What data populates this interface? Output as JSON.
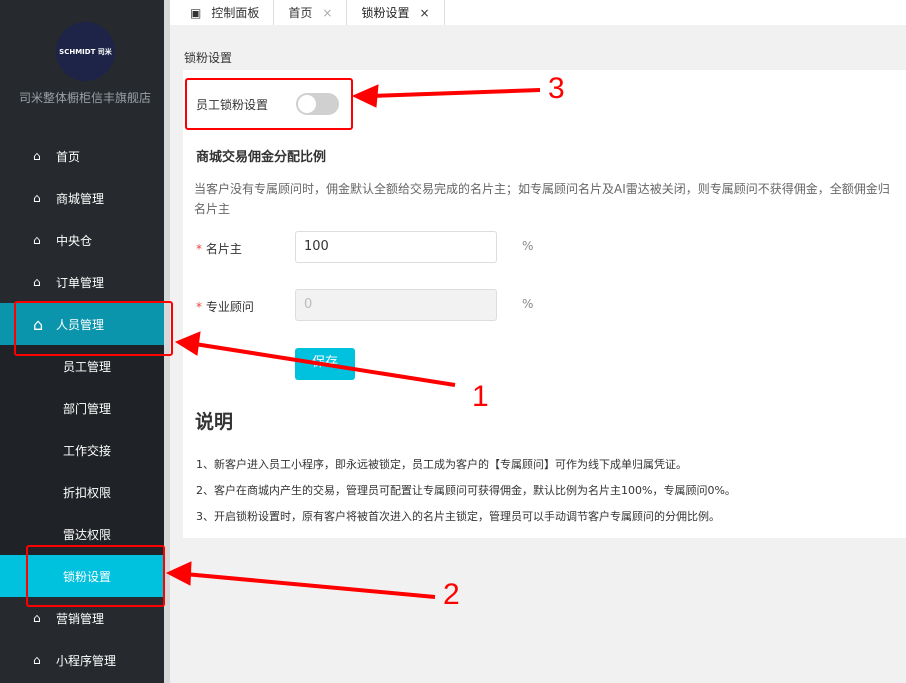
{
  "sidebar": {
    "logo_text": "SCHMIDT 司米",
    "shop_name": "司米整体橱柜信丰旗舰店",
    "items": [
      {
        "label": "首页"
      },
      {
        "label": "商城管理"
      },
      {
        "label": "中央仓"
      },
      {
        "label": "订单管理"
      },
      {
        "label": "人员管理"
      }
    ],
    "sub_items": [
      {
        "label": "员工管理"
      },
      {
        "label": "部门管理"
      },
      {
        "label": "工作交接"
      },
      {
        "label": "折扣权限"
      },
      {
        "label": "雷达权限"
      },
      {
        "label": "锁粉设置"
      }
    ],
    "items_after": [
      {
        "label": "营销管理"
      },
      {
        "label": "小程序管理"
      }
    ]
  },
  "tabs": [
    {
      "label": "控制面板",
      "icon": "dashboard-icon"
    },
    {
      "label": "首页"
    },
    {
      "label": "锁粉设置"
    }
  ],
  "breadcrumb": "锁粉设置",
  "form": {
    "lock_label": "员工锁粉设置",
    "lock_enabled": false,
    "section_title": "商城交易佣金分配比例",
    "description": "当客户没有专属顾问时，佣金默认全额给交易完成的名片主；如专属顾问名片及AI雷达被关闭，则专属顾问不获得佣金，全额佣金归名片主",
    "owner_label": "名片主",
    "owner_value": "100",
    "advisor_label": "专业顾问",
    "advisor_value": "0",
    "unit": "%",
    "required_mark": "*",
    "save_label": "保存"
  },
  "notes": {
    "title": "说明",
    "lines": [
      "1、新客户进入员工小程序，即永远被锁定，员工成为客户的【专属顾问】可作为线下成单归属凭证。",
      "2、客户在商城内产生的交易，管理员可配置让专属顾问可获得佣金，默认比例为名片主100%，专属顾问0%。",
      "3、开启锁粉设置时，原有客户将被首次进入的名片主锁定，管理员可以手动调节客户专属顾问的分佣比例。"
    ]
  },
  "annotations": [
    "1",
    "2",
    "3"
  ],
  "colors": {
    "sidebar": "#262a2e",
    "active": "#0a95ad",
    "accent": "#00c1de",
    "annotation": "#ff0000"
  }
}
